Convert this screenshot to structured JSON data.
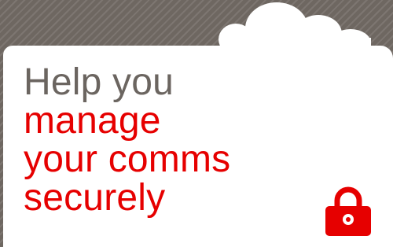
{
  "banner": {
    "headline": {
      "line_1": "Help you",
      "line_2": "manage",
      "line_3": "your comms",
      "line_4": "securely"
    },
    "icon": "padlock-icon",
    "decoration": "cloud-shape",
    "colors": {
      "accent": "#e60000",
      "muted_text": "#6b6560",
      "background": "#6e6761",
      "panel": "#ffffff"
    }
  }
}
